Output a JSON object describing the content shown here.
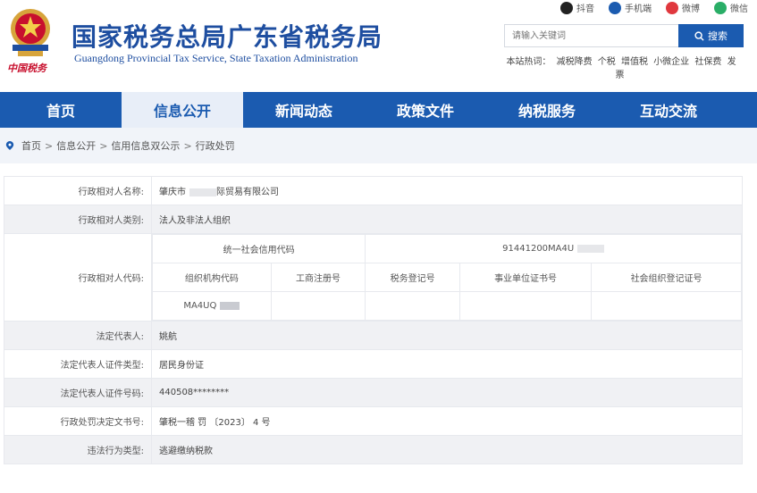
{
  "header": {
    "title": "国家税务总局广东省税务局",
    "subtitle": "Guangdong Provincial Tax Service, State Taxation Administration",
    "emblem_caption": "中国税务"
  },
  "social": [
    {
      "label": "抖音",
      "icon": "douyin-icon",
      "color": "#222222"
    },
    {
      "label": "手机端",
      "icon": "mobile-icon",
      "color": "#1b5bb0"
    },
    {
      "label": "微博",
      "icon": "weibo-icon",
      "color": "#e0383e"
    },
    {
      "label": "微信",
      "icon": "wechat-icon",
      "color": "#2aae67"
    }
  ],
  "search": {
    "placeholder": "请输入关键词",
    "button_label": "搜索"
  },
  "hot_words": {
    "prefix": "本站热词：",
    "items": [
      "减税降费",
      "个税",
      "增值税",
      "小微企业",
      "社保费",
      "发票"
    ]
  },
  "nav": {
    "items": [
      "首页",
      "信息公开",
      "新闻动态",
      "政策文件",
      "纳税服务",
      "互动交流"
    ],
    "active": 1
  },
  "breadcrumb": [
    "首页",
    "信息公开",
    "信用信息双公示",
    "行政处罚"
  ],
  "record": {
    "name_label": "行政相对人名称:",
    "name_value": "肇庆市",
    "name_value_tail": "际贸易有限公司",
    "category_label": "行政相对人类别:",
    "category_value": "法人及非法人组织",
    "code_label": "行政相对人代码:",
    "credit_code_label": "统一社会信用代码",
    "credit_code_value": "91441200MA4U",
    "sub_headers": [
      "组织机构代码",
      "工商注册号",
      "税务登记号",
      "事业单位证书号",
      "社会组织登记证号"
    ],
    "org_code_value": "MA4UQ",
    "legal_rep_label": "法定代表人:",
    "legal_rep_value": "姚航",
    "id_type_label": "法定代表人证件类型:",
    "id_type_value": "居民身份证",
    "id_no_label": "法定代表人证件号码:",
    "id_no_value": "440508********",
    "decision_label": "行政处罚决定文书号:",
    "decision_value": "肇税一稽 罚 〔2023〕 4 号",
    "violation_label": "违法行为类型:",
    "violation_value": "逃避缴纳税款"
  },
  "colors": {
    "brand_blue": "#1b5bb0",
    "title_blue": "#1e4ea0",
    "emblem_red": "#c8102e"
  }
}
